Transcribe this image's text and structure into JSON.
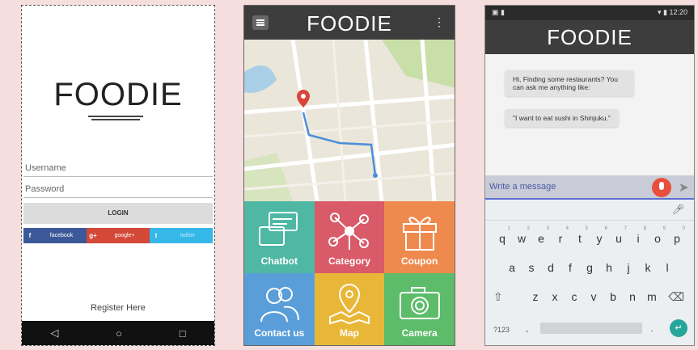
{
  "login_screen": {
    "logo": "FOODIE",
    "username_placeholder": "Username",
    "password_placeholder": "Password",
    "login_label": "LOGIN",
    "socials": [
      {
        "icon": "f",
        "label": "facebook",
        "color": "#3b5998"
      },
      {
        "icon": "g+",
        "label": "google+",
        "color": "#d34836"
      },
      {
        "icon": "t",
        "label": "twitter",
        "color": "#35b8e8"
      }
    ],
    "register_label": "Register Here"
  },
  "home_screen": {
    "title": "FOODIE",
    "tiles": [
      {
        "label": "Chatbot",
        "color": "#4fb8a5",
        "icon": "chat-windows-icon"
      },
      {
        "label": "Category",
        "color": "#d95a68",
        "icon": "network-icon"
      },
      {
        "label": "Coupon",
        "color": "#ef8a4e",
        "icon": "gift-icon"
      },
      {
        "label": "Contact us",
        "color": "#5a9ed9",
        "icon": "people-icon"
      },
      {
        "label": "Map",
        "color": "#e9b737",
        "icon": "map-pin-icon"
      },
      {
        "label": "Camera",
        "color": "#5cbc6a",
        "icon": "camera-icon"
      }
    ]
  },
  "chat_screen": {
    "status_time": "12:20",
    "title": "FOODIE",
    "messages": [
      "Hi, Finding some restaurants? You can ask me anything like:",
      "\"I want to eat sushi in Shinjuku.\""
    ],
    "input_placeholder": "Write a message",
    "keyboard": {
      "row1": [
        "q",
        "w",
        "e",
        "r",
        "t",
        "y",
        "u",
        "i",
        "o",
        "p"
      ],
      "row1_hints": [
        "1",
        "2",
        "3",
        "4",
        "5",
        "6",
        "7",
        "8",
        "9",
        "0"
      ],
      "row2": [
        "a",
        "s",
        "d",
        "f",
        "g",
        "h",
        "j",
        "k",
        "l"
      ],
      "row3": [
        "z",
        "x",
        "c",
        "v",
        "b",
        "n",
        "m"
      ],
      "symbols_label": "?123",
      "comma": ",",
      "period": "."
    }
  }
}
